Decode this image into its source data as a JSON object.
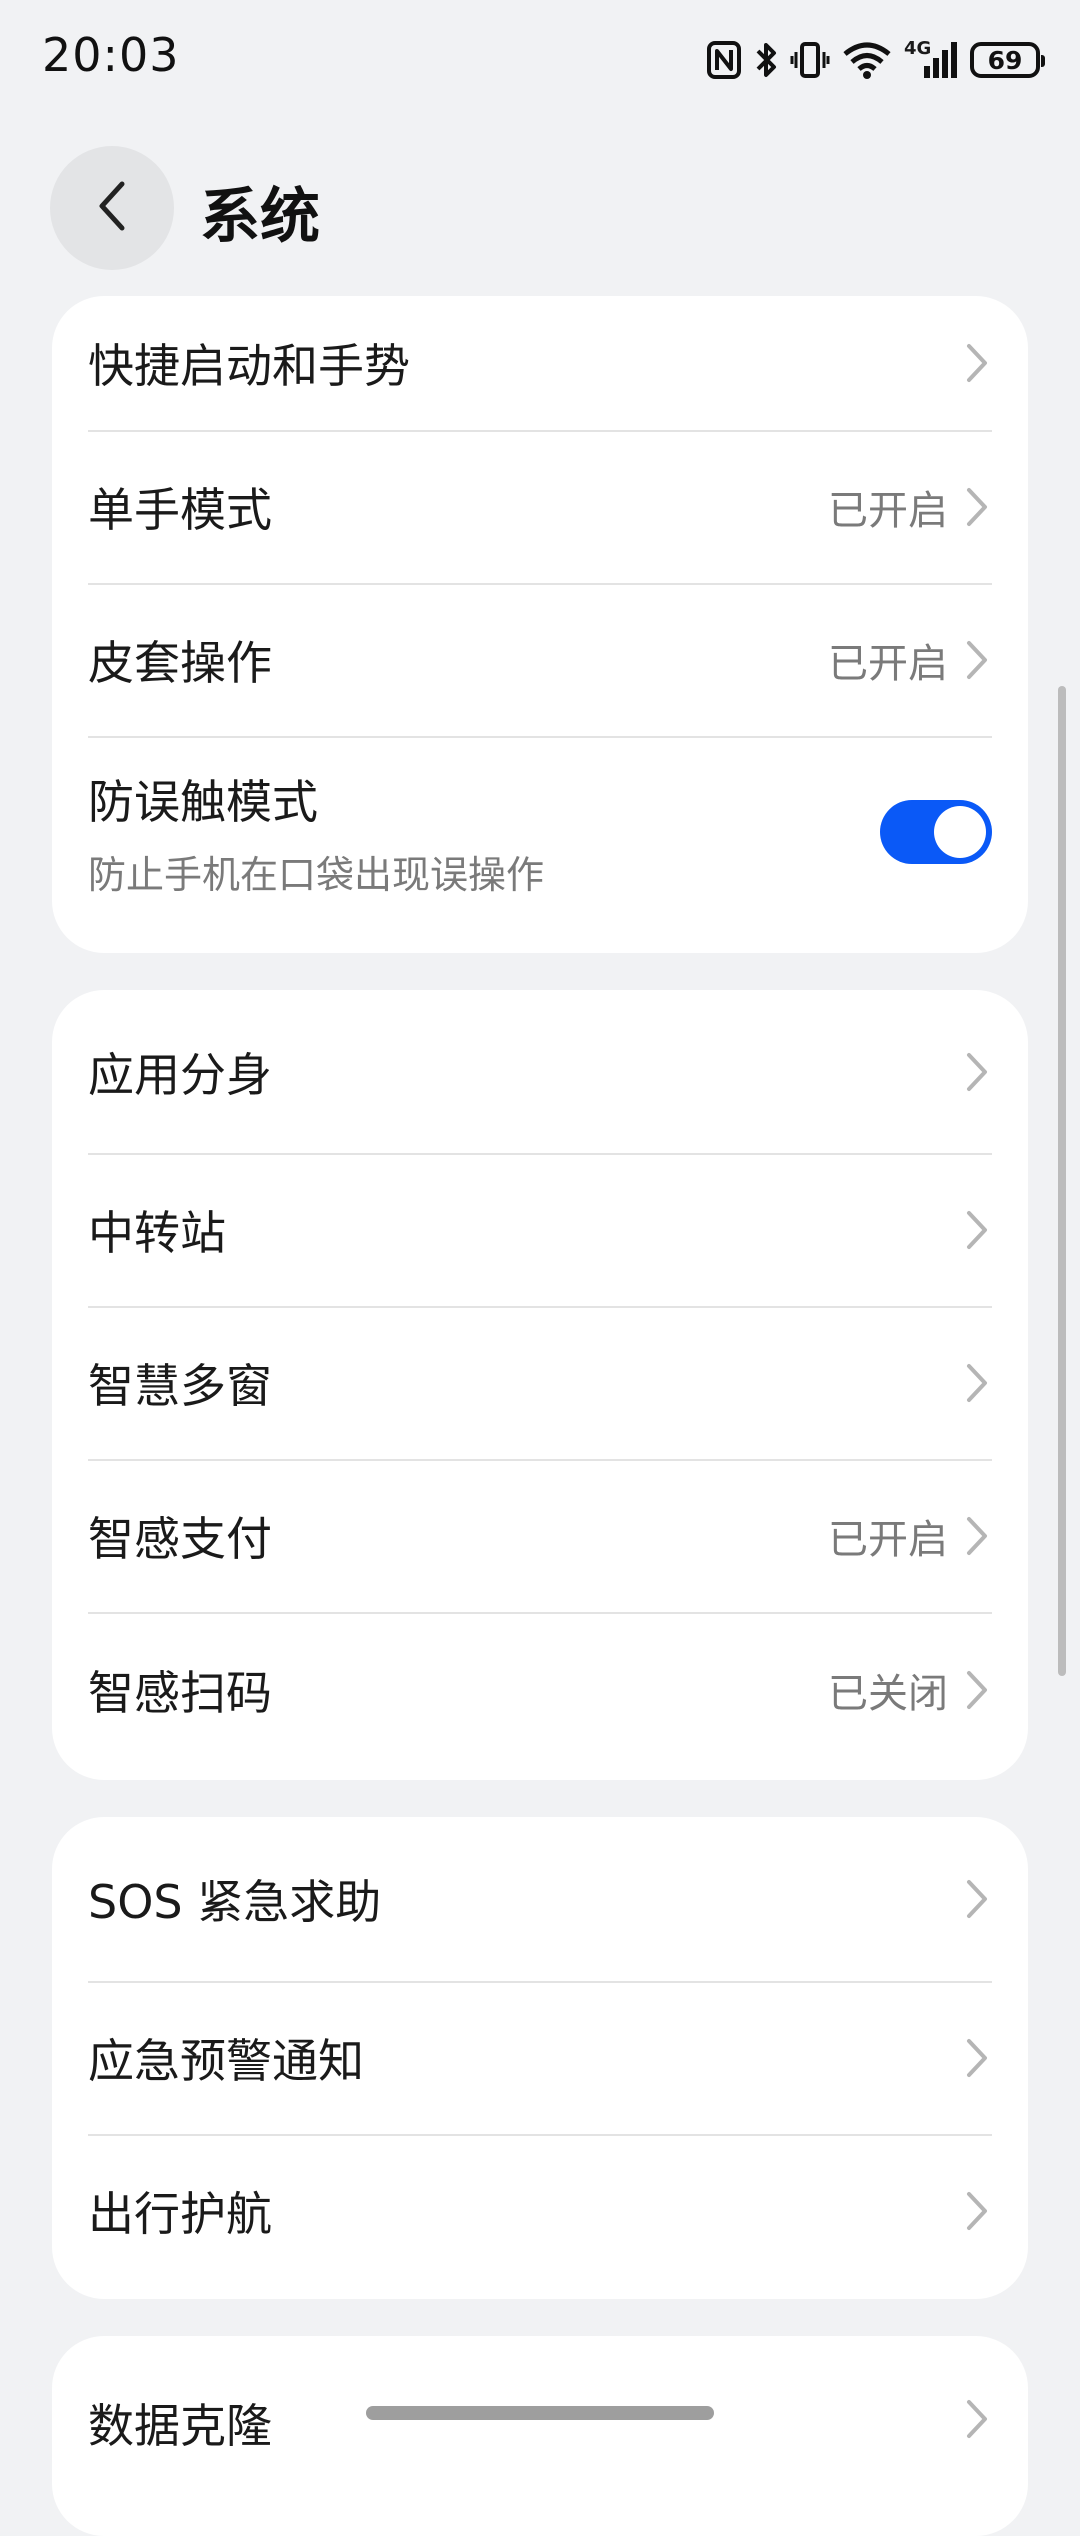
{
  "status_bar": {
    "time": "20:03",
    "icons": [
      "nfc-icon",
      "bluetooth-icon",
      "vibrate-icon",
      "wifi-icon",
      "signal-4g-icon"
    ],
    "network_label": "4G",
    "battery": "69"
  },
  "header": {
    "title": "系统",
    "back_icon": "chevron-left-icon"
  },
  "group1": {
    "items": [
      {
        "label": "快捷启动和手势",
        "value": ""
      },
      {
        "label": "单手模式",
        "value": "已开启"
      },
      {
        "label": "皮套操作",
        "value": "已开启"
      },
      {
        "label": "防误触模式",
        "sub": "防止手机在口袋出现误操作",
        "toggle_on": true
      }
    ]
  },
  "group2": {
    "items": [
      {
        "label": "应用分身",
        "value": ""
      },
      {
        "label": "中转站",
        "value": ""
      },
      {
        "label": "智慧多窗",
        "value": ""
      },
      {
        "label": "智感支付",
        "value": "已开启"
      },
      {
        "label": "智感扫码",
        "value": "已关闭"
      }
    ]
  },
  "group3": {
    "items": [
      {
        "label": "SOS 紧急求助",
        "value": ""
      },
      {
        "label": "应急预警通知",
        "value": ""
      },
      {
        "label": "出行护航",
        "value": ""
      }
    ]
  },
  "group4": {
    "items": [
      {
        "label": "数据克隆",
        "value": ""
      }
    ]
  },
  "colors": {
    "accent": "#0a59f7",
    "background": "#f1f2f4",
    "card": "#ffffff",
    "secondary_text": "#7a7a7a"
  }
}
